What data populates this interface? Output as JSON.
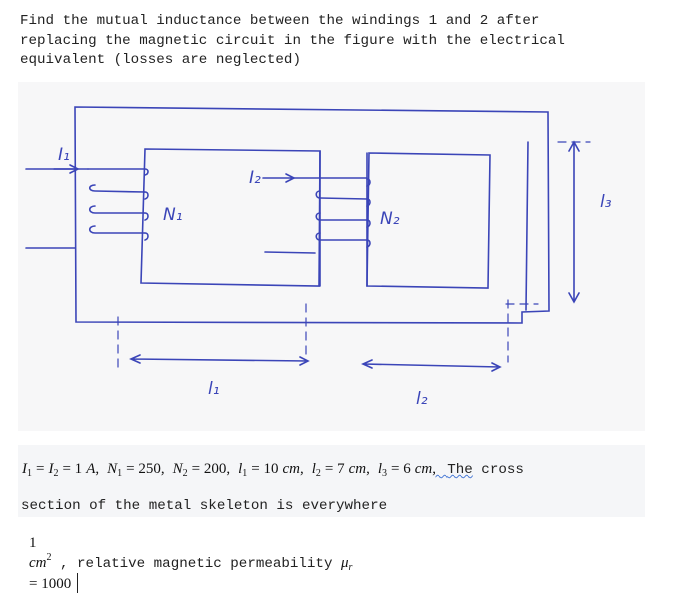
{
  "question": {
    "lines": [
      "Find the mutual inductance between the windings 1 and 2 after",
      "replacing the magnetic circuit in the figure with the electrical",
      "equivalent (losses are neglected)"
    ]
  },
  "figure": {
    "labels": {
      "current_1": "I₁",
      "current_2": "I₂",
      "winding_1": "N₁",
      "winding_2": "N₂",
      "length_1": "l₁",
      "length_2": "l₂",
      "length_3": "l₃"
    },
    "ink_color": "#3b45b8"
  },
  "params": {
    "I1": "I",
    "I1_sub": "1",
    "I2": "I",
    "I2_sub": "2",
    "current_value": "= 1",
    "current_unit": "A",
    "N1": "N",
    "N1_sub": "1",
    "N1_value": "= 250,",
    "N2": "N",
    "N2_sub": "2",
    "N2_value": "= 200,",
    "l1": "l",
    "l1_sub": "1",
    "l1_value": "= 10",
    "l1_unit": "cm",
    "l2": "l",
    "l2_sub": "2",
    "l2_value": "= 7",
    "l2_unit": "cm",
    "l3": "l",
    "l3_sub": "3",
    "l3_value": "= 6",
    "l3_unit": "cm",
    "text_after": "The",
    "text_cross": " cross",
    "line2": "section of the metal skeleton is everywhere",
    "area_value": "1",
    "area_unit": "cm",
    "area_exp": "2",
    "line3_text": " , relative magnetic permeability ",
    "mu": "μ",
    "mu_sub": "r",
    "mu_value": "= 1000"
  }
}
